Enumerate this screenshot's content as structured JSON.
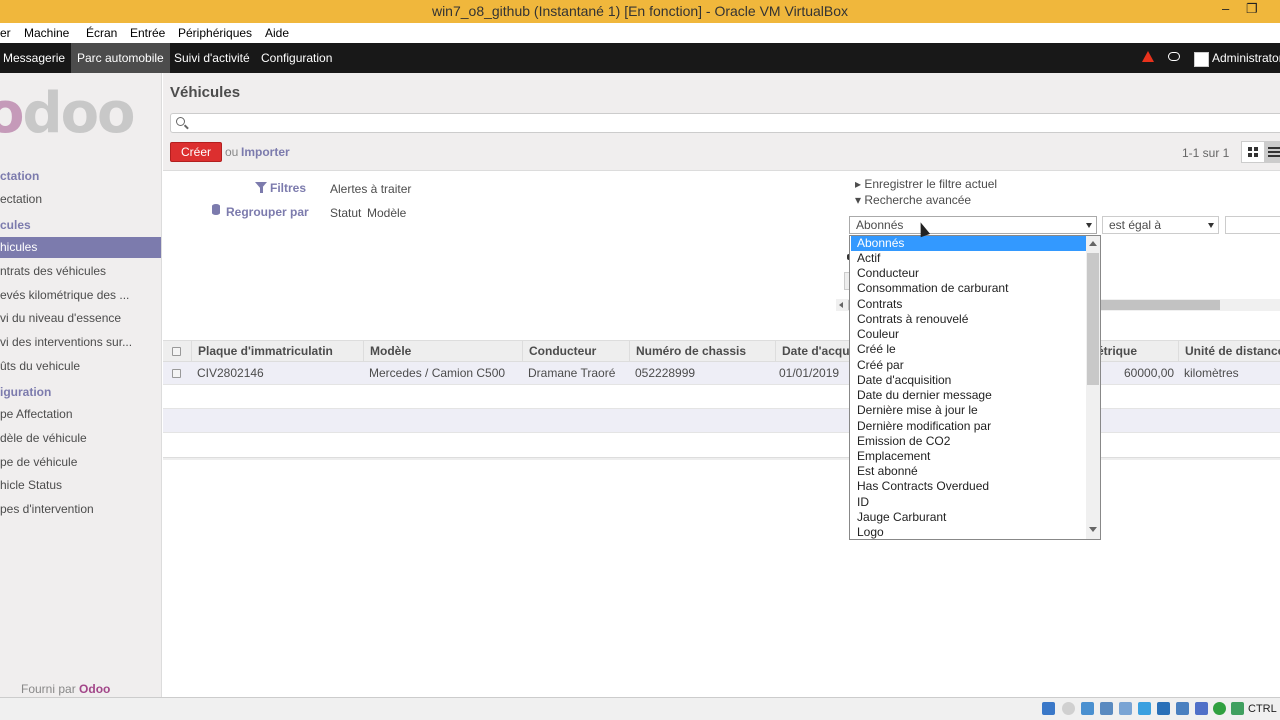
{
  "window": {
    "title": "win7_o8_github (Instantané 1) [En fonction] - Oracle VM VirtualBox",
    "minimize": "–",
    "restore": "❐"
  },
  "vbox_menu": [
    "er",
    "Machine",
    "Écran",
    "Entrée",
    "Périphériques",
    "Aide"
  ],
  "topnav": {
    "items": [
      "Messagerie",
      "Parc automobile",
      "Suivi d'activité",
      "Configuration"
    ],
    "active": "Parc automobile",
    "user": "Administrator"
  },
  "sidebar": {
    "logo": "odoo",
    "sections": [
      {
        "label": "ctation",
        "items": [
          "ectation"
        ]
      },
      {
        "label": "cules",
        "items": [
          "hicules",
          "ntrats des véhicules",
          "evés kilométrique des ...",
          "vi du niveau d'essence",
          "vi des interventions sur...",
          "ûts du vehicule"
        ]
      },
      {
        "label": "iguration",
        "items": [
          "pe Affectation",
          "dèle de véhicule",
          "pe de véhicule",
          "hicle Status",
          "pes d'intervention"
        ]
      }
    ],
    "active_item": "hicules",
    "footer_prefix": "Fourni par",
    "footer_brand": "Odoo"
  },
  "main": {
    "title": "Véhicules",
    "create_label": "Créer",
    "or_label": "ou",
    "import_label": "Importer",
    "pager": "1-1 sur 1"
  },
  "drawer": {
    "filters_label": "Filtres",
    "filter_option": "Alertes à traiter",
    "groupby_label": "Regrouper par",
    "groupby_options": [
      "Statut",
      "Modèle"
    ],
    "save_filter": "▸ Enregistrer le filtre actuel",
    "advanced_search": "▾ Recherche avancée",
    "field_select": "Abonnés",
    "operator_select": "est égal à"
  },
  "table": {
    "columns": [
      "Plaque d'immatriculatin",
      "Modèle",
      "Conducteur",
      "Numéro de chassis",
      "Date d'acqui",
      "étrique",
      "Unité de distance"
    ],
    "rows": [
      [
        "CIV2802146",
        "Mercedes / Camion C500",
        "Dramane Traoré",
        "052228999",
        "01/01/2019",
        "60000,00",
        "kilomètres"
      ]
    ]
  },
  "dropdown": {
    "selected": "Abonnés",
    "options": [
      "Abonnés",
      "Actif",
      "Conducteur",
      "Consommation de carburant",
      "Contrats",
      "Contrats à renouvelé",
      "Couleur",
      "Créé le",
      "Créé par",
      "Date d'acquisition",
      "Date du dernier message",
      "Dernière mise à jour le",
      "Dernière modification par",
      "Emission de CO2",
      "Emplacement",
      "Est abonné",
      "Has Contracts Overdued",
      "ID",
      "Jauge Carburant",
      "Logo"
    ]
  },
  "vbox_status": {
    "host_key": "CTRL D"
  },
  "colors": {
    "titlebar": "#f0b73c",
    "odoo_purple": "#7c7bad",
    "create_red": "#dc2f2f",
    "topnav": "#181818",
    "selection_blue": "#3399ff"
  }
}
